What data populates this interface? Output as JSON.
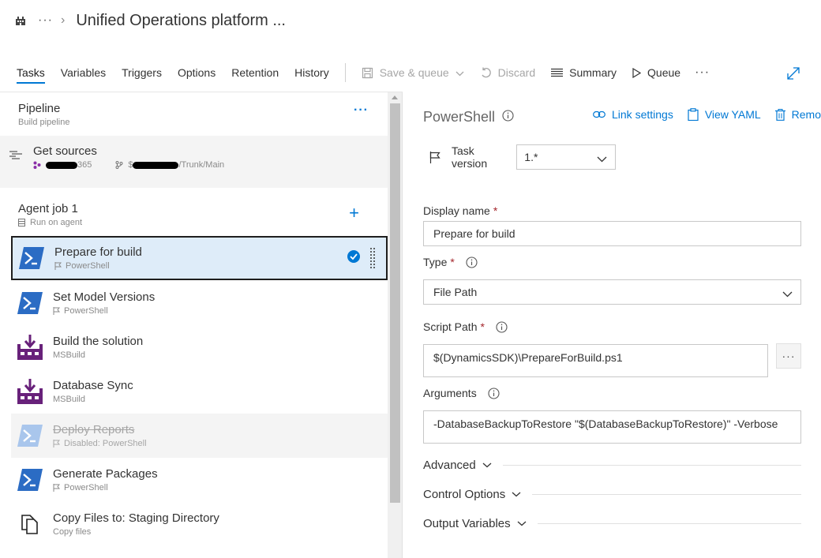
{
  "breadcrumb": {
    "more": "···",
    "separator": "›",
    "title": "Unified Operations platform ..."
  },
  "toolbar": {
    "tabs": [
      "Tasks",
      "Variables",
      "Triggers",
      "Options",
      "Retention",
      "History"
    ],
    "active_tab": "Tasks",
    "save_queue": "Save & queue",
    "discard": "Discard",
    "summary": "Summary",
    "queue": "Queue",
    "more": "···"
  },
  "pipeline": {
    "name": "Pipeline",
    "sub": "Build pipeline",
    "menu": "···"
  },
  "sources": {
    "name": "Get sources",
    "repo_suffix": "365",
    "branch_prefix": "$",
    "branch_suffix": "/Trunk/Main"
  },
  "agent": {
    "name": "Agent job 1",
    "sub": "Run on agent",
    "add": "+"
  },
  "tasks": [
    {
      "name": "Prepare for build",
      "sub": "PowerShell",
      "icon": "powershell-icon",
      "selected": true
    },
    {
      "name": "Set Model Versions",
      "sub": "PowerShell",
      "icon": "powershell-icon"
    },
    {
      "name": "Build the solution",
      "sub": "MSBuild",
      "icon": "msbuild-icon"
    },
    {
      "name": "Database Sync",
      "sub": "MSBuild",
      "icon": "msbuild-icon"
    },
    {
      "name": "Deploy Reports",
      "sub": "Disabled: PowerShell",
      "icon": "powershell-icon",
      "disabled": true
    },
    {
      "name": "Generate Packages",
      "sub": "PowerShell",
      "icon": "powershell-icon"
    },
    {
      "name": "Copy Files to: Staging Directory",
      "sub": "Copy files",
      "icon": "copy-files-icon"
    }
  ],
  "detail": {
    "title": "PowerShell",
    "link_settings": "Link settings",
    "view_yaml": "View YAML",
    "remove": "Remo",
    "task_version_label": "Task version",
    "task_version_value": "1.*",
    "display_name_label": "Display name",
    "display_name_value": "Prepare for build",
    "type_label": "Type",
    "type_value": "File Path",
    "script_path_label": "Script Path",
    "script_path_value": "$(DynamicsSDK)\\PrepareForBuild.ps1",
    "browse": "···",
    "arguments_label": "Arguments",
    "arguments_value": "-DatabaseBackupToRestore \"$(DatabaseBackupToRestore)\" -Verbose",
    "required_mark": "*",
    "sections": [
      "Advanced",
      "Control Options",
      "Output Variables"
    ]
  },
  "colors": {
    "accent": "#0078d4",
    "powershell": "#2b6cc4",
    "msbuild": "#68217a",
    "selected_bg": "#deecf9",
    "required": "#a4262c"
  }
}
